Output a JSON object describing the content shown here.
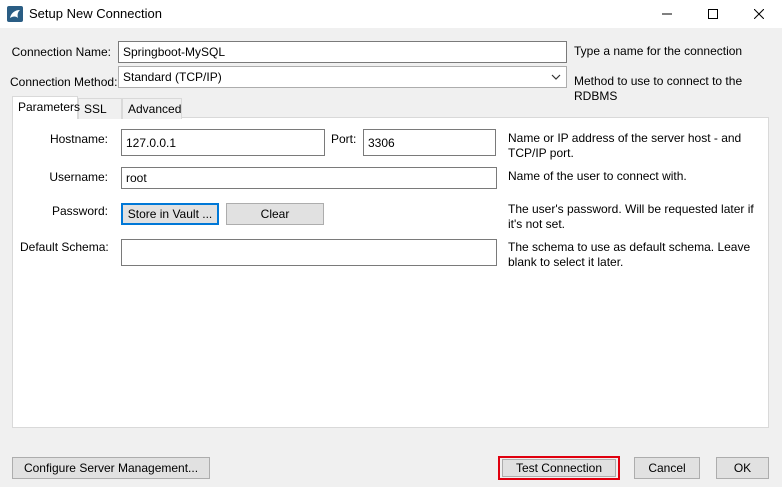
{
  "window": {
    "title": "Setup New Connection",
    "icons": {
      "app": "mysql-dolphin-icon",
      "minimize": "minimize-icon",
      "maximize": "maximize-icon",
      "close": "close-icon"
    }
  },
  "connection_name": {
    "label": "Connection Name:",
    "value": "Springboot-MySQL",
    "hint": "Type a name for the connection"
  },
  "connection_method": {
    "label": "Connection Method:",
    "value": "Standard (TCP/IP)",
    "hint": "Method to use to connect to the RDBMS"
  },
  "tabs": [
    {
      "label": "Parameters",
      "active": true
    },
    {
      "label": "SSL",
      "active": false
    },
    {
      "label": "Advanced",
      "active": false
    }
  ],
  "parameters": {
    "hostname": {
      "label": "Hostname:",
      "value": "127.0.0.1"
    },
    "port": {
      "label": "Port:",
      "value": "3306"
    },
    "host_hint": "Name or IP address of the server host - and TCP/IP port.",
    "username": {
      "label": "Username:",
      "value": "root",
      "hint": "Name of the user to connect with."
    },
    "password": {
      "label": "Password:",
      "store_button": "Store in Vault ...",
      "clear_button": "Clear",
      "hint": "The user's password. Will be requested later if it's not set."
    },
    "default_schema": {
      "label": "Default Schema:",
      "value": "",
      "hint": "The schema to use as default schema. Leave blank to select it later."
    }
  },
  "footer": {
    "configure_button": "Configure Server Management...",
    "test_button": "Test Connection",
    "cancel_button": "Cancel",
    "ok_button": "OK"
  },
  "colors": {
    "highlight": "#e0000f",
    "focus": "#0078d7",
    "background": "#f0f0f0"
  }
}
